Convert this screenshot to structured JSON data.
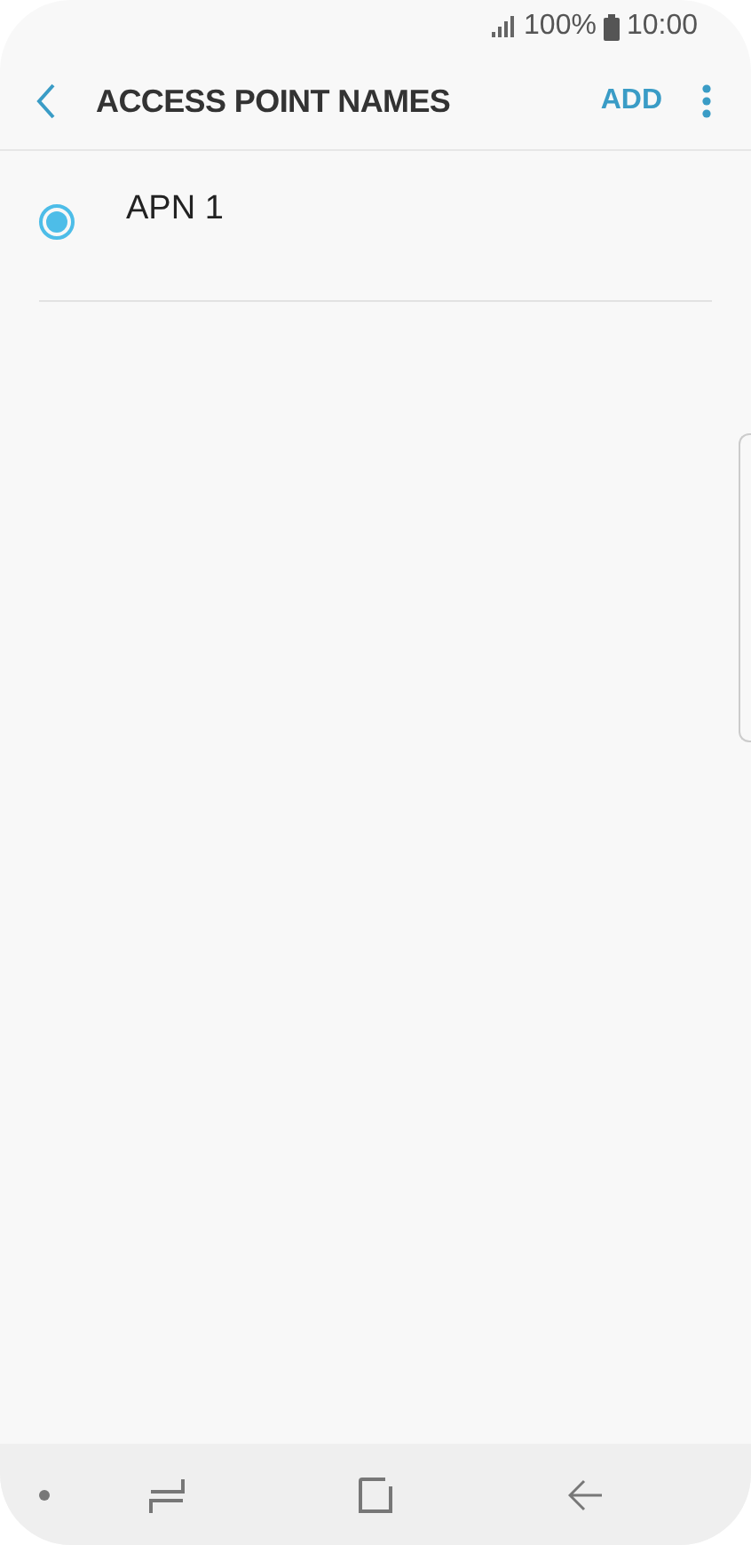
{
  "status_bar": {
    "battery": "100%",
    "time": "10:00"
  },
  "header": {
    "title": "ACCESS POINT NAMES",
    "action": "ADD"
  },
  "apns": [
    {
      "name": "APN 1",
      "selected": true
    }
  ]
}
